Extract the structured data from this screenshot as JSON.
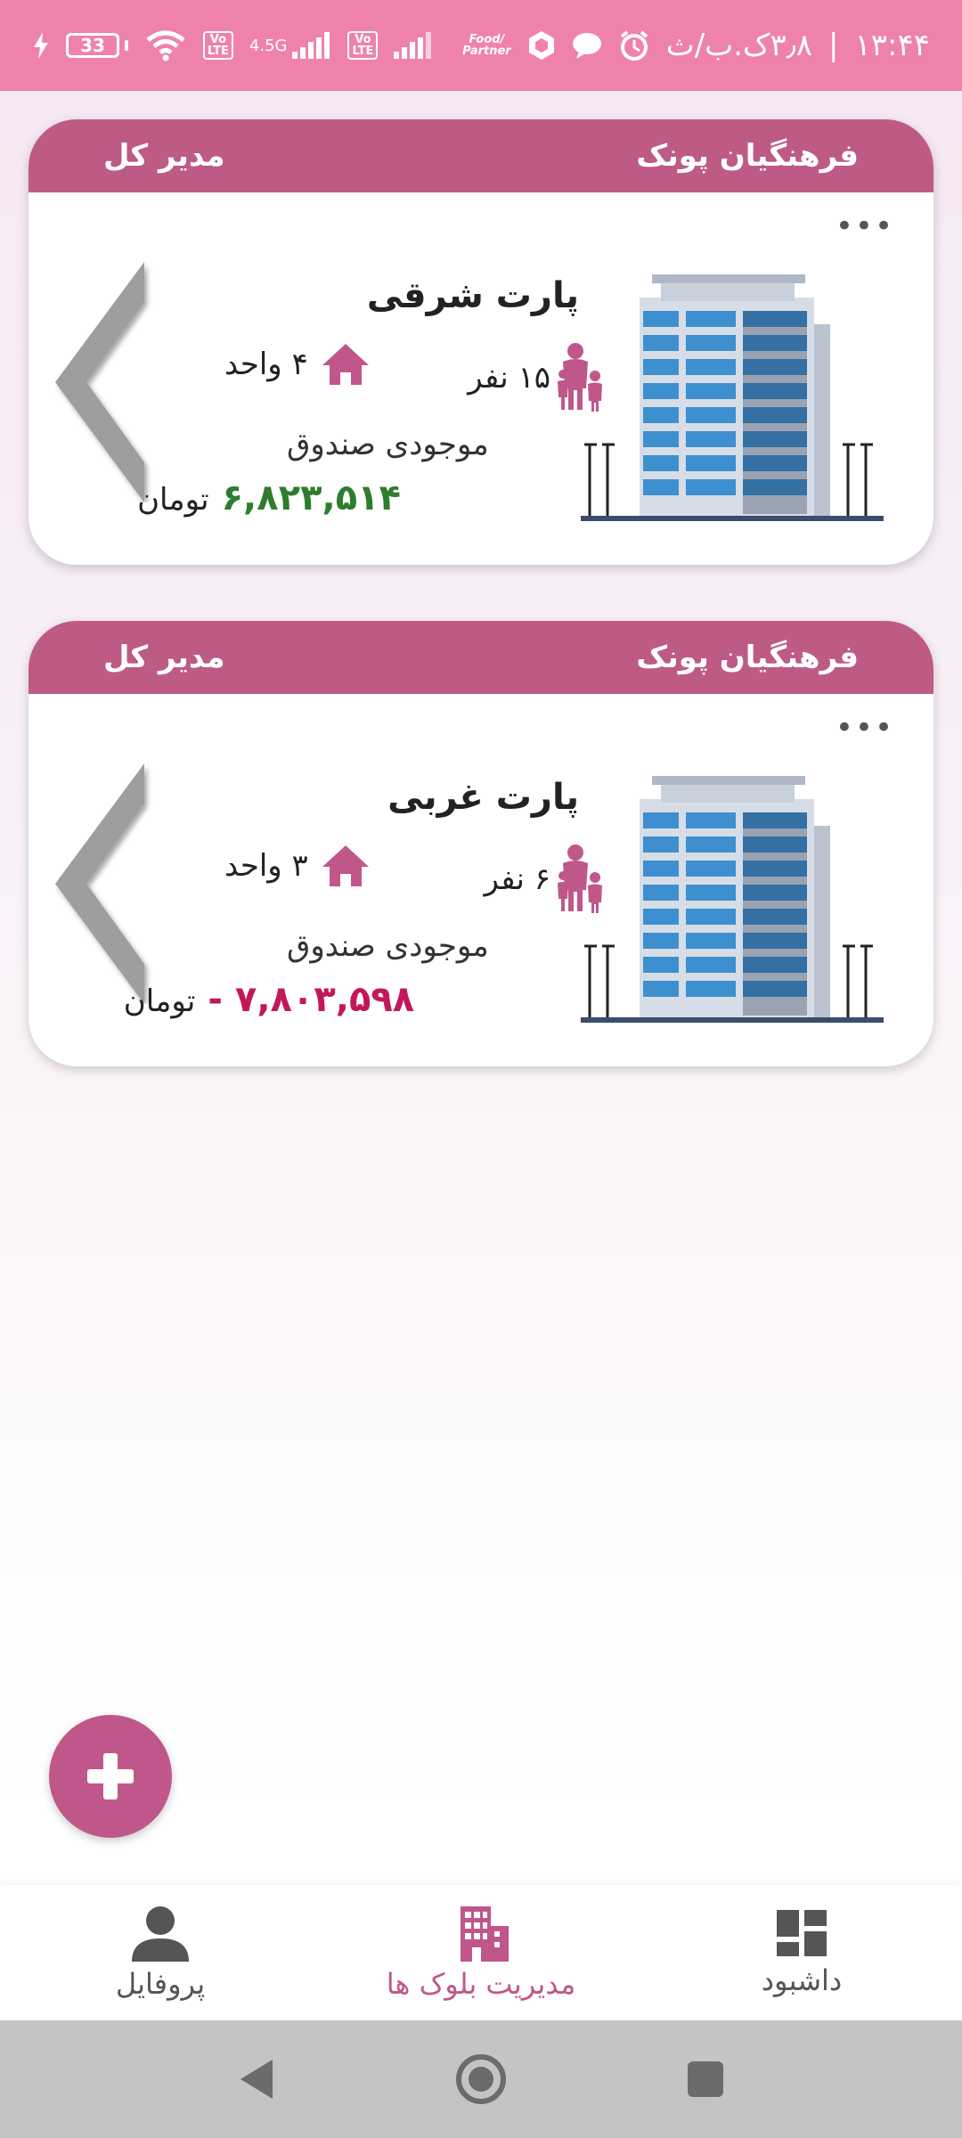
{
  "status_bar": {
    "time": "۱۳:۴۴",
    "date": "۳٫۸ک.ب/ث",
    "battery": "33",
    "network_4g": "4.5G",
    "volte_label": "Vo\nLTE",
    "food_partner": "Food/\nPartner"
  },
  "cards": [
    {
      "header_left": "مدیر کل",
      "header_right": "فرهنگیان پونک",
      "name": "پارت شرقی",
      "people": "۱۵ نفر",
      "units": "۴ واحد",
      "fund_label": "موجودی صندوق",
      "balance": "۶,۸۲۳,۵۱۴",
      "currency": "تومان",
      "more": "•••"
    },
    {
      "header_left": "مدیر کل",
      "header_right": "فرهنگیان پونک",
      "name": "پارت غربی",
      "people": "۶ نفر",
      "units": "۳ واحد",
      "fund_label": "موجودی صندوق",
      "balance": "- ۷,۸۰۳,۵۹۸",
      "currency": "تومان",
      "more": "•••"
    }
  ],
  "bottom_nav": {
    "profile": "پروفایل",
    "blocks": "مدیریت بلوک ها",
    "dashboard": "داشبود"
  },
  "colors": {
    "status_bar": "#ef82ab",
    "header": "#bd5b86",
    "accent": "#c0578a",
    "positive": "#2e7d2e",
    "negative": "#c2185b"
  }
}
